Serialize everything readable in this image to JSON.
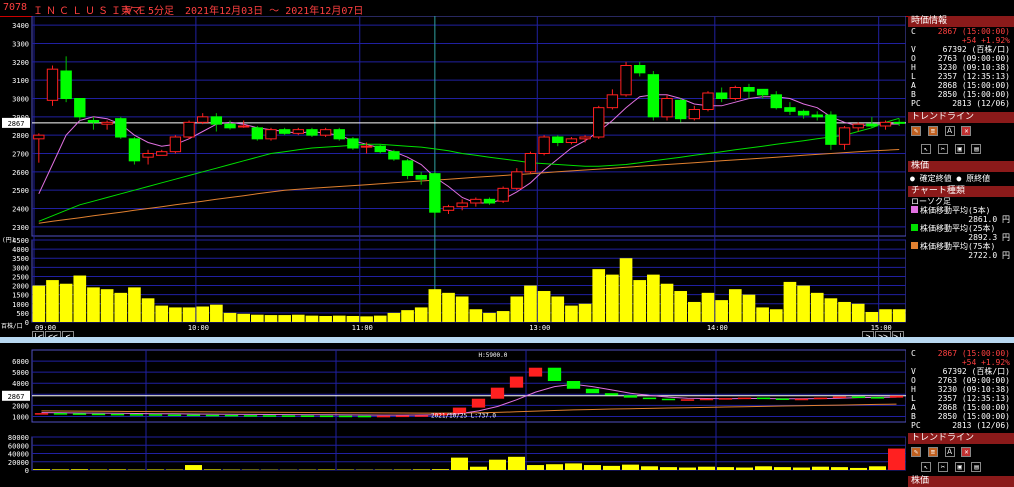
{
  "header": {
    "code": "7078",
    "name": "ＩＮＣＬＵＳＩＶＥ",
    "market": "東マ",
    "interval": "5分足",
    "range": "2021年12月03日 ～ 2021年12月07日"
  },
  "info_panel": {
    "title": "時価情報",
    "rows": [
      {
        "k": "C",
        "v": "2867 (15:00:00)"
      },
      {
        "k": "",
        "v": "+54 +1.92%"
      },
      {
        "k": "V",
        "v": "67392 (百株/口)"
      },
      {
        "k": "O",
        "v": "2763 (09:00:00)"
      },
      {
        "k": "H",
        "v": "3230 (09:10:38)"
      },
      {
        "k": "L",
        "v": "2357 (12:35:13)"
      },
      {
        "k": "A",
        "v": "2868 (15:00:00)"
      },
      {
        "k": "B",
        "v": "2850 (15:00:00)"
      },
      {
        "k": "PC",
        "v": "2813 (12/06)"
      }
    ]
  },
  "trend_panel": {
    "title": "トレンドライン"
  },
  "price_panel": {
    "title": "株価",
    "opt1": "確定終値",
    "opt2": "原終値"
  },
  "type_panel": {
    "title": "チャート種類",
    "subtitle": "ローソク足",
    "items": [
      {
        "label": "株価移動平均(5本)",
        "value": "2861.0 円",
        "color": "#e070e0"
      },
      {
        "label": "株価移動平均(25本)",
        "value": "2892.3 円",
        "color": "#00e000"
      },
      {
        "label": "株価移動平均(75本)",
        "value": "2722.0 円",
        "color": "#e08030"
      }
    ]
  },
  "lower_panel_title": "株価",
  "nav": {
    "first": "|<",
    "prev": "<<",
    "back": "<",
    "fwd": ">",
    "next": ">>",
    "last": ">|"
  },
  "chart_data": {
    "type": "candlestick",
    "x": [
      "09:00",
      "10:00",
      "11:00",
      "13:00",
      "14:00",
      "15:00"
    ],
    "price_ticks": [
      2300,
      2400,
      2500,
      2600,
      2700,
      2800,
      2900,
      3000,
      3100,
      3200,
      3300,
      3400
    ],
    "price_unit": "(円)",
    "ylim": [
      2250,
      3450
    ],
    "current_price": "2867",
    "volume_ticks": [
      0,
      500,
      1000,
      1500,
      2000,
      2500,
      3000,
      3500,
      4000,
      4500
    ],
    "volume_unit": "百株/口",
    "volume_ylim": [
      0,
      4500
    ],
    "candles": [
      {
        "o": 2780,
        "h": 2810,
        "l": 2650,
        "c": 2800
      },
      {
        "o": 2990,
        "h": 3180,
        "l": 2960,
        "c": 3160
      },
      {
        "o": 3150,
        "h": 3230,
        "l": 2980,
        "c": 3000
      },
      {
        "o": 3000,
        "h": 3000,
        "l": 2880,
        "c": 2900
      },
      {
        "o": 2880,
        "h": 2900,
        "l": 2830,
        "c": 2870
      },
      {
        "o": 2860,
        "h": 2880,
        "l": 2830,
        "c": 2870
      },
      {
        "o": 2890,
        "h": 2900,
        "l": 2780,
        "c": 2790
      },
      {
        "o": 2780,
        "h": 2790,
        "l": 2640,
        "c": 2660
      },
      {
        "o": 2680,
        "h": 2720,
        "l": 2640,
        "c": 2700
      },
      {
        "o": 2690,
        "h": 2720,
        "l": 2690,
        "c": 2710
      },
      {
        "o": 2710,
        "h": 2800,
        "l": 2700,
        "c": 2790
      },
      {
        "o": 2790,
        "h": 2880,
        "l": 2780,
        "c": 2870
      },
      {
        "o": 2870,
        "h": 2920,
        "l": 2860,
        "c": 2900
      },
      {
        "o": 2900,
        "h": 2920,
        "l": 2820,
        "c": 2860
      },
      {
        "o": 2860,
        "h": 2880,
        "l": 2830,
        "c": 2840
      },
      {
        "o": 2850,
        "h": 2880,
        "l": 2840,
        "c": 2850
      },
      {
        "o": 2840,
        "h": 2850,
        "l": 2770,
        "c": 2780
      },
      {
        "o": 2780,
        "h": 2840,
        "l": 2770,
        "c": 2830
      },
      {
        "o": 2830,
        "h": 2840,
        "l": 2800,
        "c": 2810
      },
      {
        "o": 2810,
        "h": 2840,
        "l": 2800,
        "c": 2830
      },
      {
        "o": 2830,
        "h": 2840,
        "l": 2790,
        "c": 2800
      },
      {
        "o": 2800,
        "h": 2840,
        "l": 2790,
        "c": 2830
      },
      {
        "o": 2830,
        "h": 2840,
        "l": 2770,
        "c": 2780
      },
      {
        "o": 2780,
        "h": 2790,
        "l": 2720,
        "c": 2730
      },
      {
        "o": 2740,
        "h": 2760,
        "l": 2700,
        "c": 2740
      },
      {
        "o": 2740,
        "h": 2750,
        "l": 2700,
        "c": 2710
      },
      {
        "o": 2710,
        "h": 2720,
        "l": 2660,
        "c": 2670
      },
      {
        "o": 2660,
        "h": 2670,
        "l": 2560,
        "c": 2580
      },
      {
        "o": 2580,
        "h": 2600,
        "l": 2530,
        "c": 2560
      },
      {
        "o": 2590,
        "h": 2600,
        "l": 2350,
        "c": 2380
      },
      {
        "o": 2390,
        "h": 2420,
        "l": 2370,
        "c": 2410
      },
      {
        "o": 2410,
        "h": 2450,
        "l": 2390,
        "c": 2430
      },
      {
        "o": 2430,
        "h": 2460,
        "l": 2410,
        "c": 2450
      },
      {
        "o": 2450,
        "h": 2460,
        "l": 2420,
        "c": 2430
      },
      {
        "o": 2440,
        "h": 2520,
        "l": 2430,
        "c": 2510
      },
      {
        "o": 2510,
        "h": 2620,
        "l": 2500,
        "c": 2600
      },
      {
        "o": 2600,
        "h": 2710,
        "l": 2590,
        "c": 2700
      },
      {
        "o": 2700,
        "h": 2800,
        "l": 2690,
        "c": 2790
      },
      {
        "o": 2790,
        "h": 2800,
        "l": 2740,
        "c": 2760
      },
      {
        "o": 2760,
        "h": 2790,
        "l": 2750,
        "c": 2780
      },
      {
        "o": 2780,
        "h": 2800,
        "l": 2760,
        "c": 2790
      },
      {
        "o": 2790,
        "h": 2960,
        "l": 2780,
        "c": 2950
      },
      {
        "o": 2950,
        "h": 3050,
        "l": 2940,
        "c": 3020
      },
      {
        "o": 3020,
        "h": 3200,
        "l": 3010,
        "c": 3180
      },
      {
        "o": 3180,
        "h": 3200,
        "l": 3120,
        "c": 3140
      },
      {
        "o": 3130,
        "h": 3150,
        "l": 2880,
        "c": 2900
      },
      {
        "o": 2900,
        "h": 3020,
        "l": 2880,
        "c": 3000
      },
      {
        "o": 2990,
        "h": 3000,
        "l": 2870,
        "c": 2890
      },
      {
        "o": 2890,
        "h": 2960,
        "l": 2880,
        "c": 2940
      },
      {
        "o": 2940,
        "h": 3040,
        "l": 2930,
        "c": 3030
      },
      {
        "o": 3030,
        "h": 3060,
        "l": 2980,
        "c": 3000
      },
      {
        "o": 3000,
        "h": 3070,
        "l": 2990,
        "c": 3060
      },
      {
        "o": 3060,
        "h": 3080,
        "l": 3000,
        "c": 3040
      },
      {
        "o": 3050,
        "h": 3050,
        "l": 3000,
        "c": 3020
      },
      {
        "o": 3020,
        "h": 3040,
        "l": 2940,
        "c": 2950
      },
      {
        "o": 2950,
        "h": 2980,
        "l": 2910,
        "c": 2930
      },
      {
        "o": 2930,
        "h": 2940,
        "l": 2890,
        "c": 2910
      },
      {
        "o": 2910,
        "h": 2930,
        "l": 2880,
        "c": 2900
      },
      {
        "o": 2910,
        "h": 2930,
        "l": 2720,
        "c": 2750
      },
      {
        "o": 2750,
        "h": 2850,
        "l": 2720,
        "c": 2840
      },
      {
        "o": 2840,
        "h": 2870,
        "l": 2820,
        "c": 2860
      },
      {
        "o": 2860,
        "h": 2900,
        "l": 2840,
        "c": 2850
      },
      {
        "o": 2850,
        "h": 2880,
        "l": 2830,
        "c": 2870
      },
      {
        "o": 2870,
        "h": 2890,
        "l": 2850,
        "c": 2867
      }
    ],
    "volume": [
      2000,
      2300,
      2100,
      2550,
      1900,
      1800,
      1600,
      1900,
      1300,
      900,
      800,
      800,
      850,
      950,
      500,
      450,
      400,
      380,
      380,
      400,
      350,
      330,
      350,
      330,
      310,
      350,
      500,
      650,
      800,
      1800,
      1600,
      1400,
      700,
      500,
      600,
      1400,
      2000,
      1700,
      1400,
      900,
      1000,
      2900,
      2600,
      3500,
      2300,
      2600,
      2100,
      1700,
      1100,
      1600,
      1200,
      1800,
      1500,
      800,
      700,
      2200,
      2000,
      1600,
      1300,
      1100,
      1000,
      550,
      700,
      700
    ],
    "ma": [
      {
        "label": "株価移動平均(5本)",
        "color": "#e070e0",
        "values": [
          2480,
          2640,
          2800,
          2880,
          2900,
          2890,
          2860,
          2800,
          2760,
          2740,
          2750,
          2780,
          2820,
          2860,
          2870,
          2860,
          2840,
          2830,
          2820,
          2810,
          2820,
          2810,
          2800,
          2770,
          2750,
          2730,
          2710,
          2680,
          2640,
          2570,
          2520,
          2460,
          2430,
          2430,
          2450,
          2490,
          2540,
          2610,
          2670,
          2730,
          2770,
          2820,
          2880,
          2950,
          3010,
          3020,
          3020,
          3000,
          2970,
          2960,
          2960,
          2980,
          3000,
          3010,
          3010,
          3000,
          2970,
          2950,
          2900,
          2870,
          2850,
          2860,
          2860,
          2861
        ]
      },
      {
        "label": "株価移動平均(25本)",
        "color": "#00e000",
        "values": [
          2330,
          2360,
          2390,
          2420,
          2440,
          2460,
          2480,
          2500,
          2520,
          2540,
          2560,
          2580,
          2600,
          2620,
          2640,
          2660,
          2680,
          2700,
          2710,
          2720,
          2730,
          2735,
          2740,
          2745,
          2750,
          2750,
          2745,
          2740,
          2735,
          2725,
          2715,
          2700,
          2690,
          2680,
          2670,
          2660,
          2650,
          2645,
          2640,
          2635,
          2630,
          2630,
          2635,
          2640,
          2650,
          2660,
          2670,
          2680,
          2690,
          2700,
          2710,
          2720,
          2730,
          2740,
          2750,
          2760,
          2770,
          2780,
          2790,
          2800,
          2820,
          2840,
          2870,
          2892
        ]
      },
      {
        "label": "株価移動平均(75本)",
        "color": "#e08030",
        "values": [
          2320,
          2330,
          2340,
          2350,
          2360,
          2370,
          2380,
          2390,
          2400,
          2410,
          2420,
          2430,
          2440,
          2450,
          2460,
          2470,
          2480,
          2490,
          2500,
          2505,
          2510,
          2515,
          2520,
          2525,
          2530,
          2535,
          2540,
          2545,
          2550,
          2555,
          2560,
          2565,
          2570,
          2575,
          2580,
          2585,
          2590,
          2595,
          2600,
          2605,
          2610,
          2615,
          2620,
          2625,
          2630,
          2635,
          2640,
          2645,
          2650,
          2655,
          2660,
          2665,
          2670,
          2675,
          2680,
          2685,
          2690,
          2695,
          2700,
          2705,
          2710,
          2714,
          2718,
          2722
        ]
      }
    ],
    "lower": {
      "price_ticks": [
        1000,
        2000,
        3000,
        4000,
        5000,
        6000
      ],
      "ylim": [
        500,
        7000
      ],
      "volume_ticks": [
        0,
        20000,
        40000,
        60000,
        80000
      ],
      "vol_ylim": [
        0,
        80000
      ],
      "current_price": "2867",
      "low_label": "2021/10/25 L:737.0",
      "high_label": "H:5900.0",
      "close": [
        1300,
        1280,
        1250,
        1230,
        1210,
        1200,
        1180,
        1170,
        1150,
        1140,
        1120,
        1110,
        1100,
        1090,
        1080,
        1070,
        1060,
        1050,
        1060,
        1080,
        1100,
        1300,
        1800,
        2600,
        3600,
        4600,
        5400,
        4200,
        3500,
        3100,
        2900,
        2700,
        2600,
        2500,
        2550,
        2600,
        2650,
        2700,
        2620,
        2500,
        2600,
        2700,
        2800,
        2750,
        2700,
        2867
      ],
      "ma": [
        1350,
        1330,
        1310,
        1300,
        1290,
        1270,
        1250,
        1240,
        1220,
        1210,
        1200,
        1190,
        1180,
        1170,
        1160,
        1150,
        1140,
        1130,
        1120,
        1120,
        1130,
        1160,
        1250,
        1500,
        1900,
        2500,
        3200,
        3700,
        3900,
        3700,
        3400,
        3100,
        2900,
        2750,
        2650,
        2620,
        2600,
        2620,
        2620,
        2600,
        2590,
        2610,
        2650,
        2700,
        2720,
        2750
      ],
      "ma_long": [
        1500,
        1490,
        1480,
        1470,
        1460,
        1450,
        1440,
        1430,
        1420,
        1410,
        1400,
        1390,
        1380,
        1370,
        1360,
        1350,
        1340,
        1330,
        1320,
        1310,
        1300,
        1300,
        1310,
        1330,
        1370,
        1420,
        1480,
        1540,
        1590,
        1630,
        1670,
        1700,
        1730,
        1760,
        1790,
        1820,
        1850,
        1880,
        1910,
        1940,
        1970,
        2000,
        2030,
        2060,
        2090,
        2120
      ],
      "volume": [
        2000,
        1500,
        1800,
        1200,
        1500,
        1000,
        1300,
        1100,
        12000,
        1500,
        1000,
        900,
        800,
        700,
        900,
        1200,
        1000,
        800,
        900,
        1100,
        1500,
        2000,
        30000,
        8000,
        25000,
        32000,
        12000,
        14000,
        16000,
        12000,
        10000,
        13000,
        9000,
        7000,
        6000,
        8000,
        7000,
        6000,
        9000,
        7000,
        6000,
        8000,
        7000,
        5000,
        9000,
        52000
      ]
    }
  }
}
